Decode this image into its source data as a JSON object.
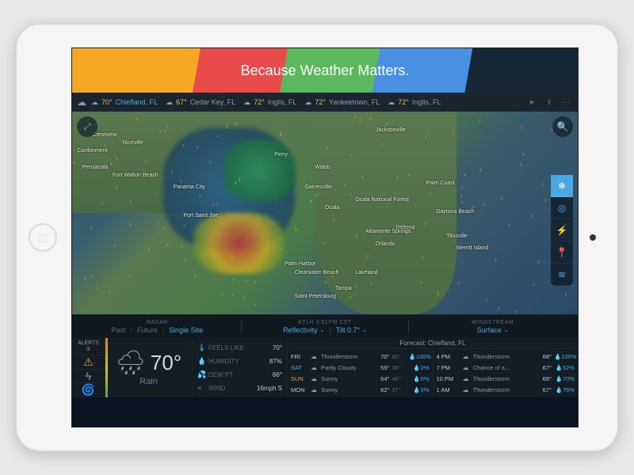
{
  "banner": {
    "text": "Because Weather Matters."
  },
  "topbar": {
    "locations": [
      {
        "temp": "70°",
        "name": "Chiefland, FL",
        "active": true
      },
      {
        "temp": "67°",
        "name": "Cedar Key, FL"
      },
      {
        "temp": "72°",
        "name": "Inglis, FL"
      },
      {
        "temp": "72°",
        "name": "Yankeetown, FL"
      },
      {
        "temp": "72°",
        "name": "Inglis, FL"
      }
    ]
  },
  "map": {
    "labels": [
      "Crestview",
      "Niceville",
      "Pensacola",
      "Cantonment",
      "Fort Walton Beach",
      "Panama City",
      "Port Saint Joe",
      "Perry",
      "Waldo",
      "Gainesville",
      "Ocala",
      "Jacksonville",
      "Palm Coast",
      "Daytona Beach",
      "Deltona",
      "Titusville",
      "Merritt Island",
      "Orlando",
      "Tampa",
      "Saint Petersburg",
      "Clearwater Beach",
      "Palm Harbor",
      "Lakeland",
      "Altamonte Springs",
      "Ocala National Forest"
    ]
  },
  "controls": {
    "radar": {
      "label": "RADAR",
      "opts": [
        "Past",
        "Future",
        "Single Site"
      ],
      "active": 2
    },
    "station": {
      "text": "KTLH 3:51PM CST",
      "mode": "Reflectivity",
      "tilt": "Tilt 0.7°"
    },
    "wind": {
      "label": "WINDSTREAM",
      "value": "Surface"
    }
  },
  "alerts": {
    "label": "ALERTS",
    "count": "①"
  },
  "current": {
    "temp": "70°",
    "cond": "Rain"
  },
  "details": [
    {
      "k": "FEELS LIKE",
      "v": "70°"
    },
    {
      "k": "HUMIDITY",
      "v": "87%"
    },
    {
      "k": "DEW PT",
      "v": "66°"
    },
    {
      "k": "WIND",
      "v": "16mph S"
    }
  ],
  "forecast": {
    "title": "Forecast: Chiefland, FL",
    "daily": [
      {
        "day": "FRI",
        "cls": "",
        "cond": "Thunderstorm",
        "hi": "70°",
        "lo": "60°",
        "pct": "100%"
      },
      {
        "day": "SAT",
        "cls": "sat",
        "cond": "Partly Cloudy",
        "hi": "59°",
        "lo": "36°",
        "pct": "0%"
      },
      {
        "day": "SUN",
        "cls": "sun",
        "cond": "Sunny",
        "hi": "64°",
        "lo": "48°",
        "pct": "0%"
      },
      {
        "day": "MON",
        "cls": "",
        "cond": "Sunny",
        "hi": "62°",
        "lo": "37°",
        "pct": "0%"
      }
    ],
    "hourly": [
      {
        "t": "4 PM",
        "cond": "Thunderstorm",
        "temp": "68°",
        "pct": "100%"
      },
      {
        "t": "7 PM",
        "cond": "Chance of a…",
        "temp": "67°",
        "pct": "52%"
      },
      {
        "t": "10 PM",
        "cond": "Thunderstorm",
        "temp": "68°",
        "pct": "70%"
      },
      {
        "t": "1 AM",
        "cond": "Thunderstorm",
        "temp": "67°",
        "pct": "76%"
      }
    ]
  }
}
